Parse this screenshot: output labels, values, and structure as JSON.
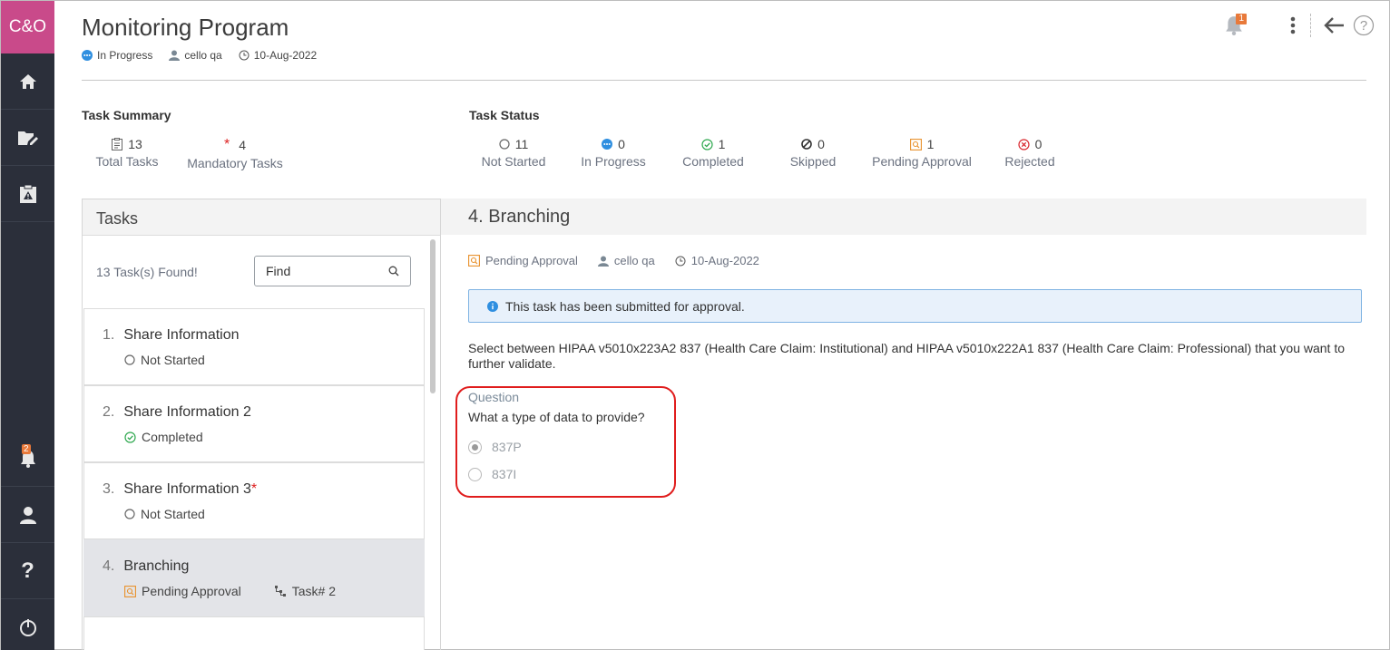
{
  "nav": {
    "brand": "C&O",
    "notification_count": "2"
  },
  "header": {
    "title": "Monitoring Program",
    "status": "In Progress",
    "user": "cello qa",
    "date": "10-Aug-2022",
    "bell_count": "1"
  },
  "summary": {
    "title": "Task Summary",
    "total": {
      "value": "13",
      "label": "Total Tasks"
    },
    "mandatory": {
      "value": "4",
      "label": "Mandatory Tasks"
    }
  },
  "status": {
    "title": "Task Status",
    "items": [
      {
        "value": "11",
        "label": "Not Started"
      },
      {
        "value": "0",
        "label": "In Progress"
      },
      {
        "value": "1",
        "label": "Completed"
      },
      {
        "value": "0",
        "label": "Skipped"
      },
      {
        "value": "1",
        "label": "Pending Approval"
      },
      {
        "value": "0",
        "label": "Rejected"
      }
    ]
  },
  "tasks": {
    "title": "Tasks",
    "found": "13 Task(s) Found!",
    "find_placeholder": "Find",
    "items": [
      {
        "num": "1.",
        "name": "Share Information",
        "status": "Not Started"
      },
      {
        "num": "2.",
        "name": "Share Information 2",
        "status": "Completed"
      },
      {
        "num": "3.",
        "name": "Share Information 3",
        "status": "Not Started",
        "mandatory": "*"
      },
      {
        "num": "4.",
        "name": "Branching",
        "status": "Pending Approval",
        "ref": "Task# 2"
      }
    ]
  },
  "detail": {
    "title": "4. Branching",
    "status": "Pending Approval",
    "user": "cello qa",
    "date": "10-Aug-2022",
    "info": "This task has been submitted for approval.",
    "description": "Select between HIPAA v5010x223A2 837 (Health Care Claim: Institutional) and HIPAA v5010x222A1 837 (Health Care Claim: Professional) that you want to further validate.",
    "question_label": "Question",
    "question": "What a type of data to provide?",
    "options": [
      "837P",
      "837I"
    ],
    "selected": "837P"
  },
  "colors": {
    "brand": "#c94a8a",
    "nav_bg": "#2b2f3a",
    "badge": "#e8793a",
    "info_blue": "#2f8fe0",
    "success": "#2fa84f",
    "pending": "#e8902a",
    "rejected": "#d9282f",
    "highlight": "#e01d1d"
  }
}
